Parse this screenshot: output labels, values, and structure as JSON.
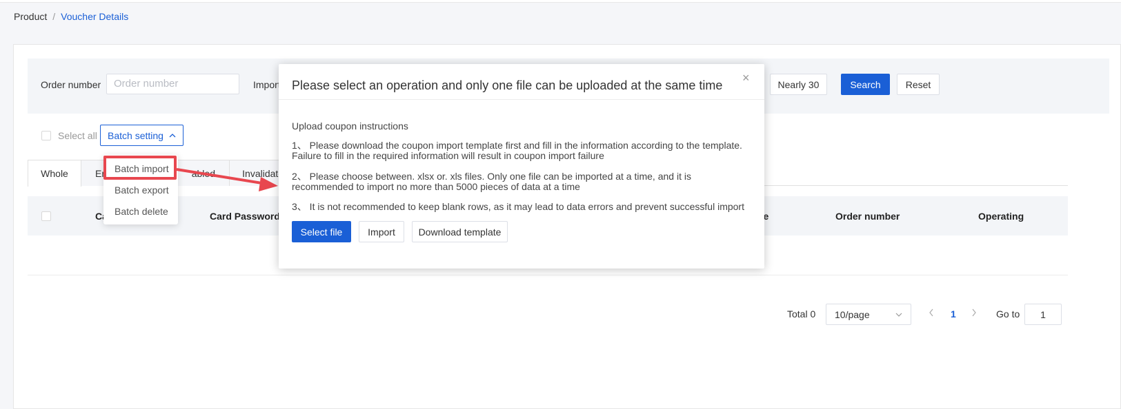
{
  "breadcrumb": {
    "parent": "Product",
    "separator": "/",
    "current": "Voucher Details"
  },
  "search": {
    "order_label": "Order number",
    "order_placeholder": "Order number",
    "import_label": "Import",
    "nearly_label": "Nearly 30",
    "search_label": "Search",
    "reset_label": "Reset"
  },
  "toolbar": {
    "select_all": "Select all",
    "batch_setting": "Batch setting"
  },
  "dropdown": {
    "items": [
      "Batch import",
      "Batch export",
      "Batch delete"
    ]
  },
  "tabs": [
    "Whole",
    "En",
    "abled",
    "Invalidated"
  ],
  "table": {
    "columns": [
      "Ca",
      "Card Password",
      "ne",
      "Order number",
      "Operating"
    ]
  },
  "pagination": {
    "total": "Total 0",
    "page_size": "10/page",
    "current_page": "1",
    "goto_label": "Go to",
    "goto_value": "1"
  },
  "modal": {
    "title": "Please select an operation and only one file can be uploaded at the same time",
    "instructions_title": "Upload coupon instructions",
    "instructions": [
      "1、 Please download the coupon import template first and fill in the information according to the template. Failure to fill in the required information will result in coupon import failure",
      "2、 Please choose between. xlsx or. xls files. Only one file can be imported at a time, and it is recommended to import no more than 5000 pieces of data at a time",
      "3、 It is not recommended to keep blank rows, as it may lead to data errors and prevent successful import"
    ],
    "select_file": "Select file",
    "import": "Import",
    "download_template": "Download template",
    "close_glyph": "×"
  },
  "colors": {
    "primary": "#1a5fd6",
    "highlight": "#e8474f",
    "panel": "#f3f5f8"
  },
  "icons": {
    "close": "close-icon",
    "chevron_up": "chevron-up-icon",
    "chevron_down": "chevron-down-icon",
    "prev": "chevron-left-icon",
    "next": "chevron-right-icon",
    "arrow": "arrow-annotation-icon"
  }
}
